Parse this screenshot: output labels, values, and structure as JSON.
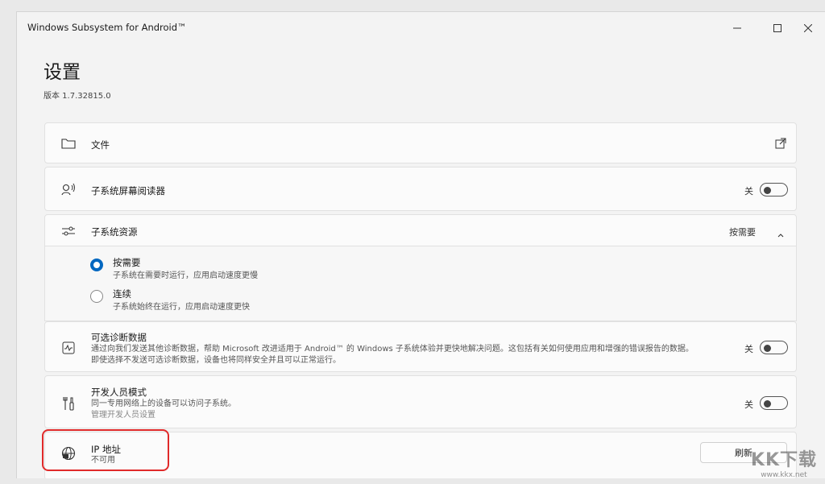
{
  "window": {
    "title": "Windows Subsystem for Android™"
  },
  "page": {
    "title": "设置",
    "version": "版本 1.7.32815.0"
  },
  "cards": {
    "files": {
      "label": "文件",
      "icon": "folder-icon",
      "action_icon": "open-external-icon"
    },
    "screen_reader": {
      "label": "子系统屏幕阅读器",
      "toggle_label": "关",
      "toggle_on": false,
      "icon": "screen-reader-icon"
    },
    "resources": {
      "label": "子系统资源",
      "selected_value": "按需要",
      "icon": "sliders-icon",
      "options": [
        {
          "label": "按需要",
          "desc": "子系统在需要时运行，应用启动速度更慢",
          "checked": true
        },
        {
          "label": "连续",
          "desc": "子系统始终在运行，应用启动速度更快",
          "checked": false
        }
      ]
    },
    "diagnostics": {
      "label": "可选诊断数据",
      "desc1": "通过向我们发送其他诊断数据，帮助 Microsoft 改进适用于 Android™ 的 Windows 子系统体验并更快地解决问题。这包括有关如何使用应用和增强的错误报告的数据。",
      "desc2": "即使选择不发送可选诊断数据，设备也将同样安全并且可以正常运行。",
      "toggle_label": "关",
      "toggle_on": false,
      "icon": "diagnostics-icon"
    },
    "developer": {
      "label": "开发人员模式",
      "desc": "同一专用网络上的设备可以访问子系统。",
      "link": "管理开发人员设置",
      "toggle_label": "关",
      "toggle_on": false,
      "icon": "tools-icon"
    },
    "ip": {
      "label": "IP 地址",
      "desc": "不可用",
      "button": "刷新",
      "icon": "globe-icon"
    }
  },
  "watermark": {
    "main": "KK下载",
    "sub": "www.kkx.net"
  },
  "colors": {
    "accent": "#0067c0",
    "highlight": "#e02a2a"
  }
}
